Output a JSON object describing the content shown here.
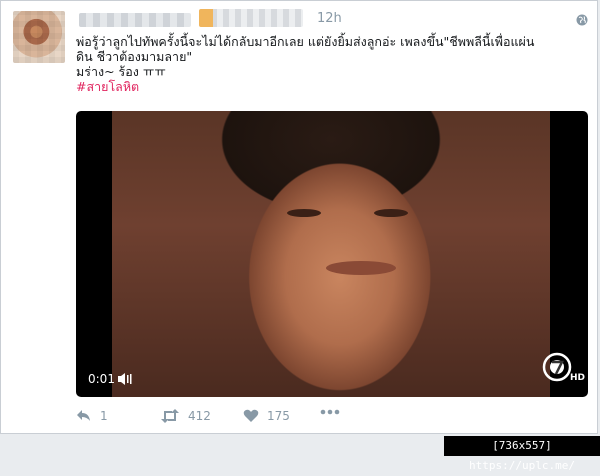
{
  "tweet": {
    "time": "12h",
    "lines": [
      "พ่อรู้ว่าลูกไปทัพครั้งนี้จะไม่ได้กลับมาอีกเลย แต่ยังยิ้มส่งลูกอ่ะ เพลงขึ้น\"ชีพพลีนี้เพื่อแผ่น",
      "ดิน ชีวาต้องมามลาย\"",
      "มร่าง~ ร้อง ㅠㅠ"
    ],
    "hashtag": "#สายโลหิต"
  },
  "video": {
    "time": "0:01",
    "quality_badge": "HD"
  },
  "actions": {
    "reply_count": "1",
    "retweet_count": "412",
    "like_count": "175"
  },
  "watermark": "[736x557] https://uplc.me/",
  "colors": {
    "accent_hashtag": "#e0245e",
    "muted": "#8899a6"
  },
  "icons": [
    "globe-icon",
    "volume-icon",
    "channel7-logo",
    "reply-icon",
    "retweet-icon",
    "like-icon",
    "more-icon"
  ]
}
